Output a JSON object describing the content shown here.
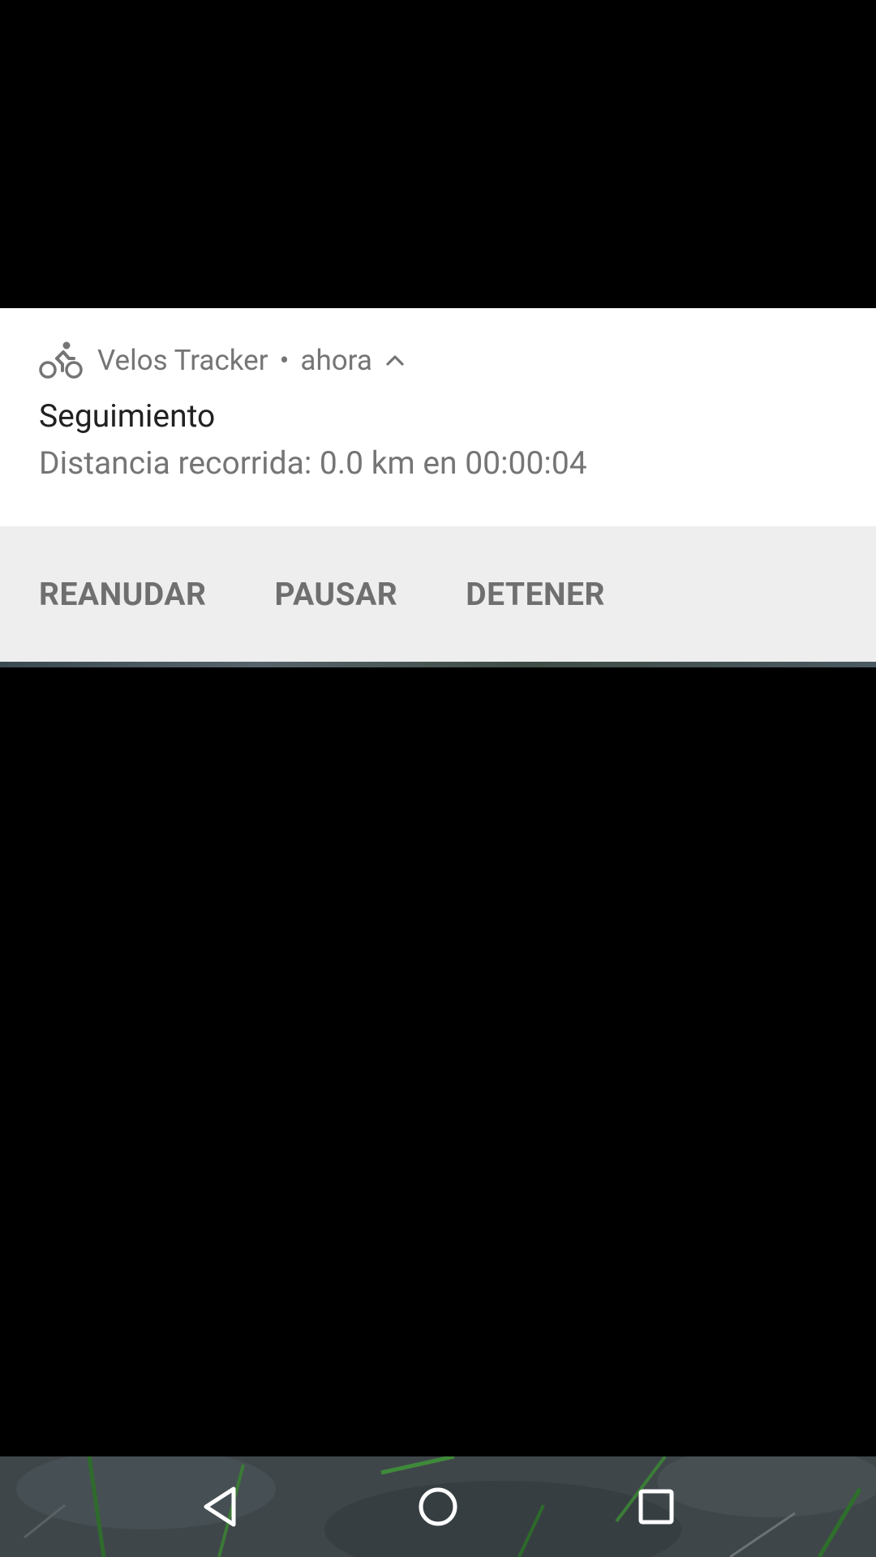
{
  "notification": {
    "app_name": "Velos Tracker",
    "separator": "•",
    "time": "ahora",
    "title": "Seguimiento",
    "text": "Distancia recorrida: 0.0 km en 00:00:04",
    "icon": "bicycle-rider-icon",
    "expand_icon": "chevron-up-icon",
    "actions": [
      {
        "label": "REANUDAR"
      },
      {
        "label": "PAUSAR"
      },
      {
        "label": "DETENER"
      }
    ]
  },
  "navigation_bar": {
    "back_icon": "back-triangle-icon",
    "home_icon": "home-circle-icon",
    "recents_icon": "recents-square-icon"
  },
  "colors": {
    "notification_bg": "#ffffff",
    "actions_bg": "#eeeeee",
    "title_text": "#212121",
    "secondary_text": "#757575",
    "background": "#000000"
  }
}
